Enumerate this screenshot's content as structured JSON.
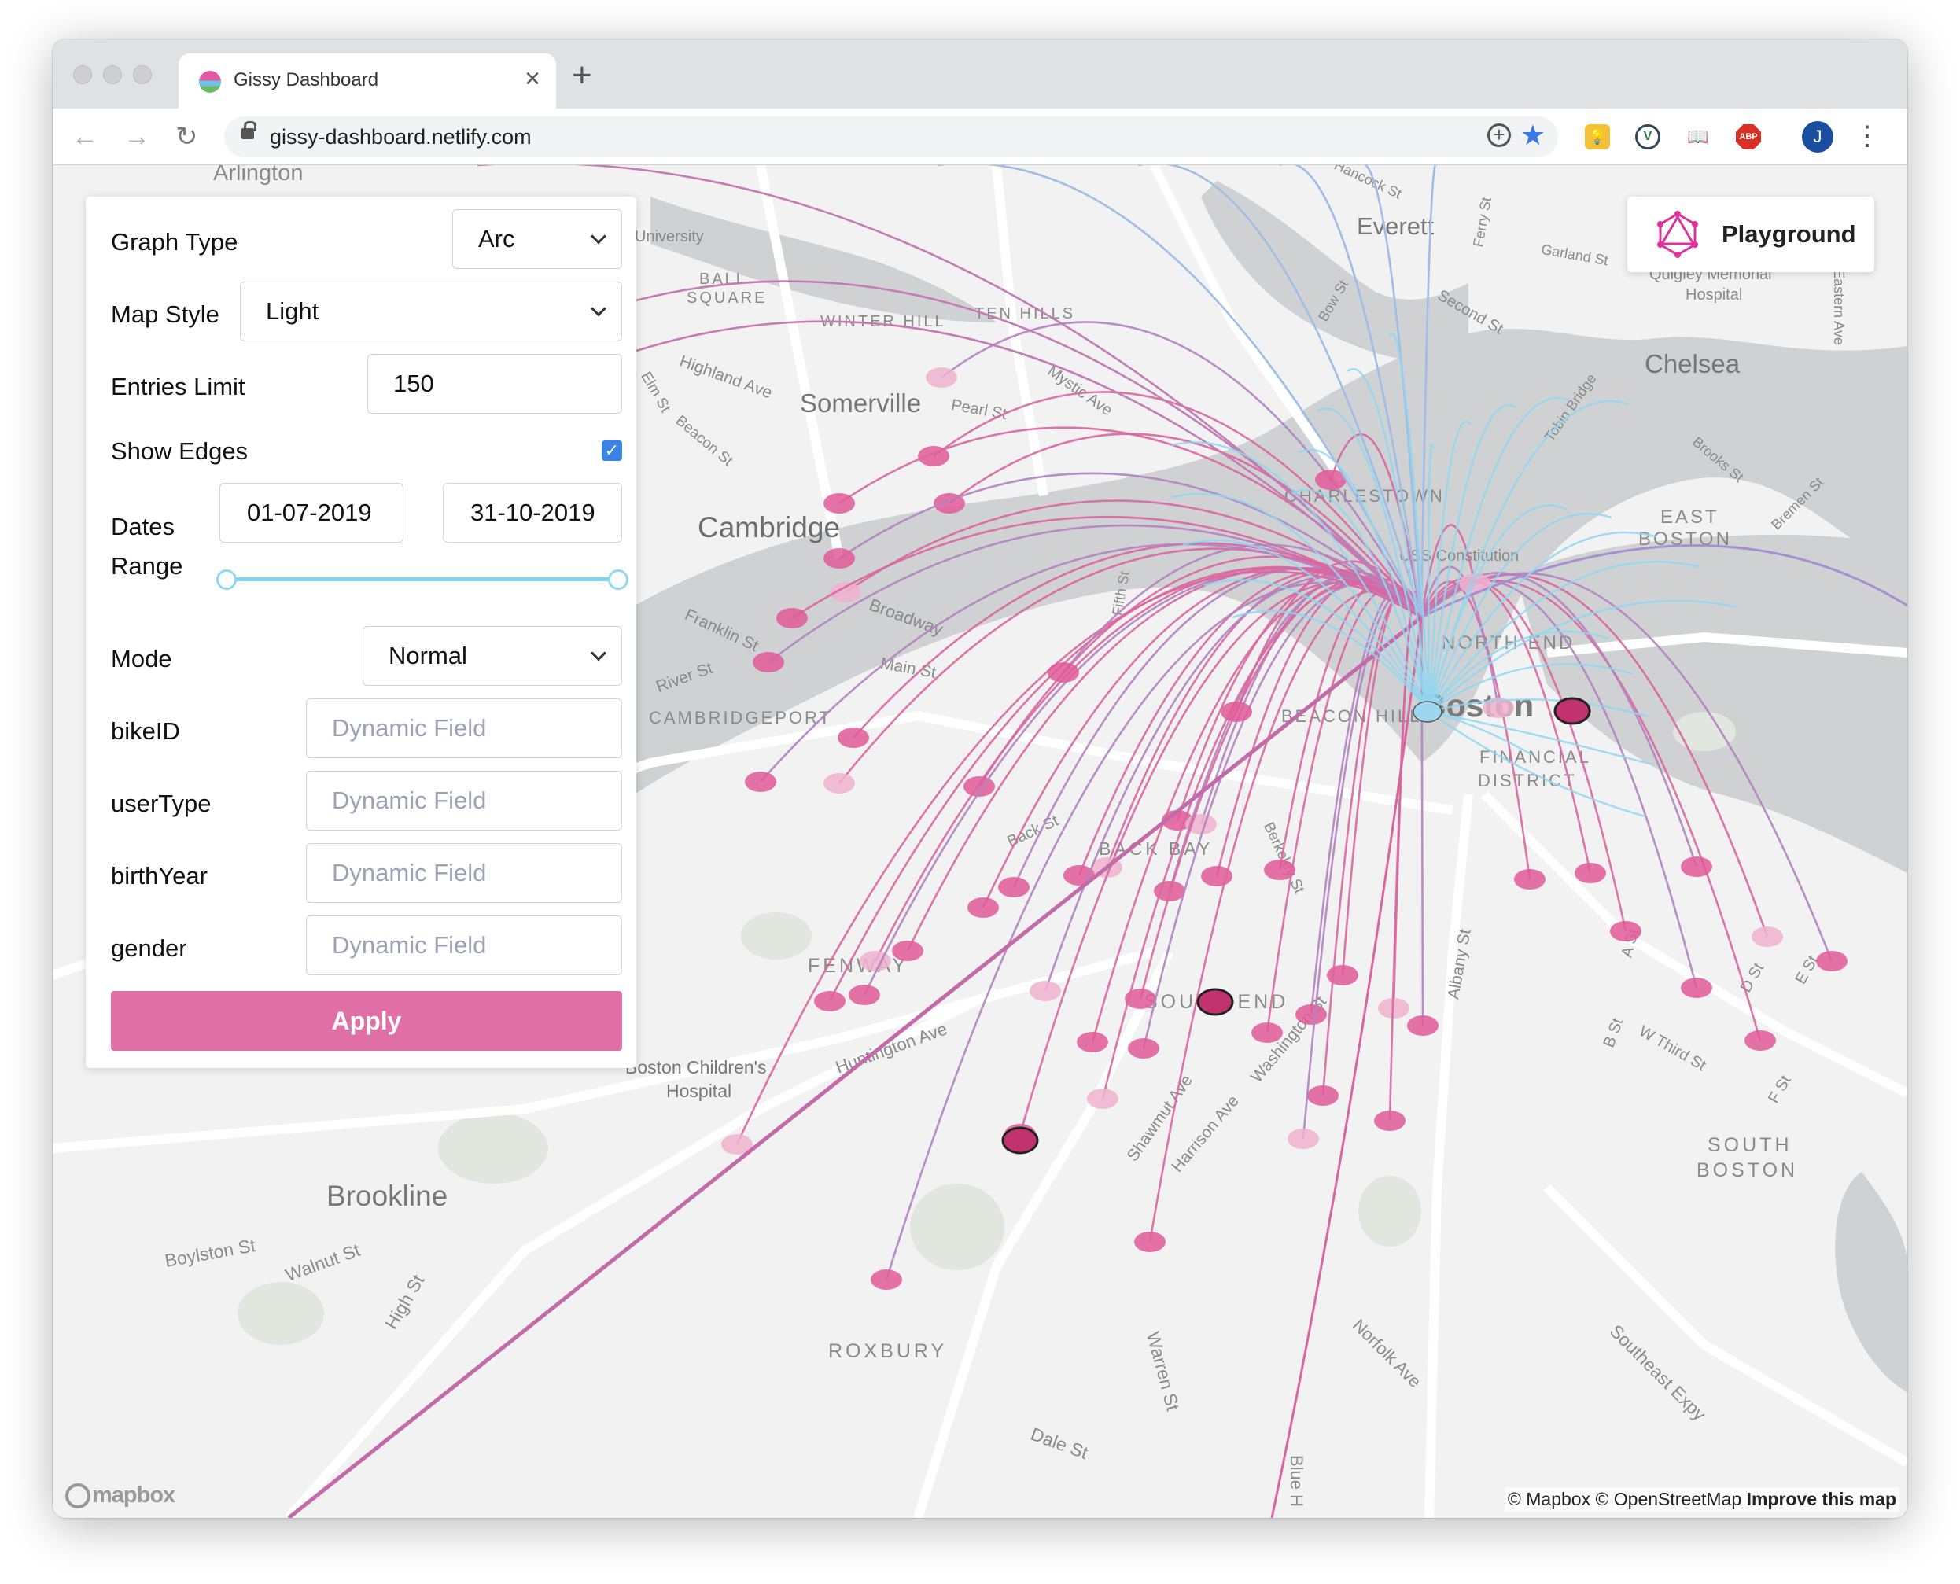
{
  "browser": {
    "tab_title": "Gissy Dashboard",
    "url": "gissy-dashboard.netlify.com",
    "profile_initial": "J",
    "extensions": [
      "lightbulb-icon",
      "vue-devtools-icon",
      "reader-icon",
      "adblock-icon"
    ],
    "adblock_label": "ABP"
  },
  "panel": {
    "graph_type_label": "Graph Type",
    "graph_type_value": "Arc",
    "map_style_label": "Map Style",
    "map_style_value": "Light",
    "entries_limit_label": "Entries Limit",
    "entries_limit_value": "150",
    "show_edges_label": "Show Edges",
    "show_edges_checked": true,
    "dates_label_1": "Dates",
    "dates_label_2": "Range",
    "date_from": "01-07-2019",
    "date_to": "31-10-2019",
    "mode_label": "Mode",
    "mode_value": "Normal",
    "dynamic_fields": [
      {
        "label": "bikeID",
        "placeholder": "Dynamic Field"
      },
      {
        "label": "userType",
        "placeholder": "Dynamic Field"
      },
      {
        "label": "birthYear",
        "placeholder": "Dynamic Field"
      },
      {
        "label": "gender",
        "placeholder": "Dynamic Field"
      }
    ],
    "apply_label": "Apply"
  },
  "playground": {
    "label": "Playground"
  },
  "map": {
    "labels": {
      "arlington": "Arlington",
      "everett": "Everett",
      "chelsea": "Chelsea",
      "somerville": "Somerville",
      "cambridge": "Cambridge",
      "east_boston_1": "EAST",
      "east_boston_2": "BOSTON",
      "charlestown": "CHARLESTOWN",
      "uss": "USS Constitution",
      "north_end": "NORTH END",
      "boston": "Boston",
      "financial_1": "FINANCIAL",
      "financial_2": "DISTRICT",
      "cambridgeport": "CAMBRIDGEPORT",
      "fenway": "FENWAY",
      "back_bay": "BACK BAY",
      "south_end": "SOUTH END",
      "beacon_hill": "BEACON HILL",
      "childrens_1": "Boston Children's",
      "childrens_2": "Hospital",
      "brookline": "Brookline",
      "roxbury": "ROXBURY",
      "south_boston_1": "SOUTH",
      "south_boston_2": "BOSTON",
      "ball_square_1": "BALL",
      "ball_square_2": "SQUARE",
      "winter_hill": "WINTER HILL",
      "ten_hills": "TEN HILLS",
      "quigley_1": "Quigley Memorial",
      "quigley_2": "Hospital",
      "university": "University",
      "huntington": "Huntington Ave",
      "boylston": "Boylston St",
      "walnut": "Walnut St",
      "high": "High St",
      "warren": "Warren St",
      "dale": "Dale St",
      "norfolk": "Norfolk Ave",
      "southeast": "Southeast Expy",
      "shawmut": "Shawmut Ave",
      "harrison": "Harrison Ave",
      "washington": "Washington St",
      "albany": "Albany St",
      "broadway": "Broadway",
      "main": "Main St",
      "river": "River St",
      "franklin": "Franklin St",
      "highland": "Highland Ave",
      "mystic": "Mystic Ave",
      "pearl": "Pearl St",
      "second": "Second St",
      "garland": "Garland St",
      "brooks": "Brooks St",
      "bremen": "Bremen St",
      "tobin": "Tobin Bridge",
      "third": "W Third St",
      "d_st": "D St",
      "e_st": "E St",
      "f_st": "F St",
      "a_st": "A St",
      "b_st": "B St",
      "blue_hill": "Blue H",
      "back_st": "Back St",
      "fifth": "Fifth St",
      "elm": "Elm St",
      "beacon": "Beacon St",
      "hancock": "Hancock St",
      "berkeley": "Berkeley St",
      "eastern": "Eastern Ave",
      "bow": "Bow St",
      "ferry": "Ferry St"
    },
    "attribution_1": "© Mapbox © OpenStreetMap",
    "attribution_2": "Improve this map",
    "logo": "mapbox",
    "colors": {
      "arc_pink": "#e05a98",
      "arc_blue": "#8fd7f2",
      "arc_purple": "#a58fd0",
      "water": "#cfd1d3",
      "land": "#f2f2f2"
    }
  }
}
